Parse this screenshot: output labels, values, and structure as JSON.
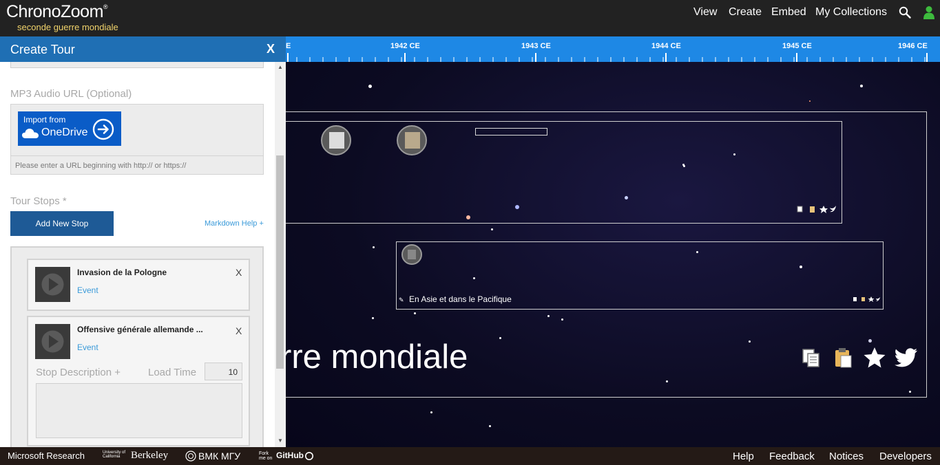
{
  "app": {
    "logo": "ChronoZoom",
    "logo_mark": "®",
    "subtitle": "seconde guerre mondiale"
  },
  "nav": {
    "view": "View",
    "create": "Create",
    "embed": "Embed",
    "collections": "My Collections"
  },
  "panel": {
    "title": "Create Tour",
    "close": "X",
    "mp3_label": "MP3 Audio URL (Optional)",
    "onedrive_import": "Import from",
    "onedrive_name": "OneDrive",
    "url_placeholder": "Please enter a URL beginning with http:// or https://",
    "tour_stops_label": "Tour Stops *",
    "add_stop": "Add New Stop",
    "markdown_help": "Markdown Help +",
    "stops": [
      {
        "title": "Invasion de la Pologne",
        "type": "Event",
        "close": "X"
      },
      {
        "title": "Offensive générale allemande ...",
        "type": "Event",
        "close": "X"
      }
    ],
    "stop_description_label": "Stop Description +",
    "load_time_label": "Load Time",
    "load_time_value": "10"
  },
  "timeline": {
    "ticks": [
      "E",
      "1942 CE",
      "1943 CE",
      "1944 CE",
      "1945 CE",
      "1946 CE"
    ],
    "asie_label": "En Asie et dans le Pacifique",
    "big_title": "rre mondiale"
  },
  "footer": {
    "microsoft": "Microsoft Research",
    "berkeley_small": "University of California",
    "berkeley": "Berkeley",
    "vmk": "ВМК МГУ",
    "fork": "Fork me on",
    "github": "GitHub",
    "help": "Help",
    "feedback": "Feedback",
    "notices": "Notices",
    "developers": "Developers"
  },
  "colors": {
    "header_bg": "#222222",
    "subtitle": "#f1d36b",
    "panel_title_bar": "#1f6fb4",
    "ruler": "#1e88e5",
    "onedrive": "#0a5cc7",
    "add_stop_button": "#1e5a96",
    "link": "#3a9ad9",
    "user_icon": "#3dbb3d",
    "footer_bg": "#241a16"
  }
}
